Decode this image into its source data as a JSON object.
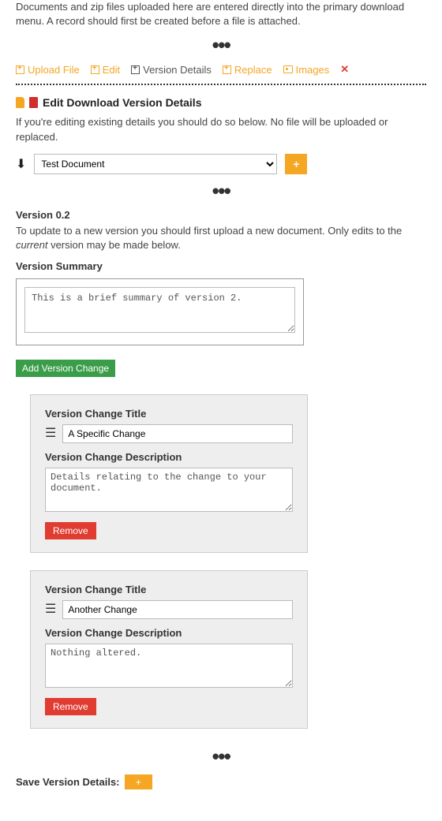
{
  "intro": "Documents and zip files uploaded here are entered directly into the primary download menu. A record should first be created before a file is attached.",
  "toolbar": {
    "upload": "Upload File",
    "edit": "Edit",
    "version_details": "Version Details",
    "replace": "Replace",
    "images": "Images"
  },
  "section": {
    "title": "Edit Download Version Details",
    "help": "If you're editing existing details you should do so below. No file will be uploaded or replaced.",
    "select_value": "Test Document",
    "select_options": [
      "Test Document"
    ]
  },
  "version": {
    "heading": "Version 0.2",
    "note_pre": "To update to a new version you should first upload a new document. Only edits to the ",
    "note_em": "current",
    "note_post": " version may be made below.",
    "summary_label": "Version Summary",
    "summary_value": "This is a brief summary of version 2.",
    "add_change_btn": "Add Version Change"
  },
  "changes": [
    {
      "title_label": "Version Change Title",
      "title_value": "A Specific Change",
      "desc_label": "Version Change Description",
      "desc_value": "Details relating to the change to your document.",
      "remove": "Remove"
    },
    {
      "title_label": "Version Change Title",
      "title_value": "Another Change",
      "desc_label": "Version Change Description",
      "desc_value": "Nothing altered.",
      "remove": "Remove"
    }
  ],
  "save": {
    "label": "Save Version Details:",
    "btn": "+"
  }
}
